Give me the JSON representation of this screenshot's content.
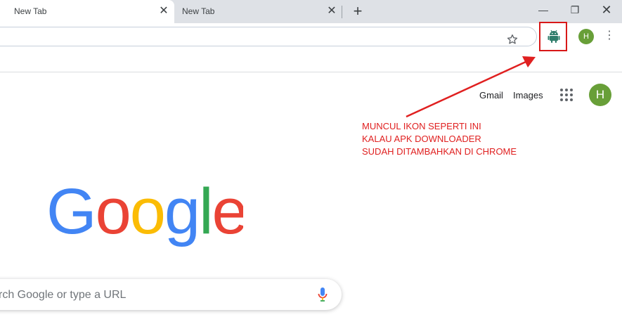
{
  "tabs": [
    {
      "title": "New Tab",
      "close": "✕"
    },
    {
      "title": "New Tab",
      "close": "✕"
    }
  ],
  "new_tab": "+",
  "window_controls": {
    "minimize": "—",
    "maximize": "❐",
    "close": "✕"
  },
  "omnibox": {
    "value": "",
    "placeholder": ""
  },
  "toolbar": {
    "bookmark_icon": "star-icon",
    "extension_icon": "android-icon",
    "extension_highlight_color": "#d81818",
    "profile_initial": "H",
    "profile_color": "#689f38",
    "menu": "⋮"
  },
  "ntp": {
    "gmail": "Gmail",
    "images": "Images",
    "apps_icon": "apps-grid-icon",
    "profile_initial": "H",
    "logo": {
      "letters": [
        "G",
        "o",
        "o",
        "g",
        "l",
        "e"
      ],
      "colors": [
        "#4285f4",
        "#ea4335",
        "#fbbc05",
        "#4285f4",
        "#34a853",
        "#ea4335"
      ]
    },
    "search_placeholder": "rch Google or type a URL",
    "mic_icon": "mic-icon"
  },
  "annotation": {
    "lines": [
      "MUNCUL IKON SEPERTI INI",
      "KALAU APK DOWNLOADER",
      "SUDAH DITAMBAHKAN DI CHROME"
    ],
    "color": "#e02020"
  }
}
